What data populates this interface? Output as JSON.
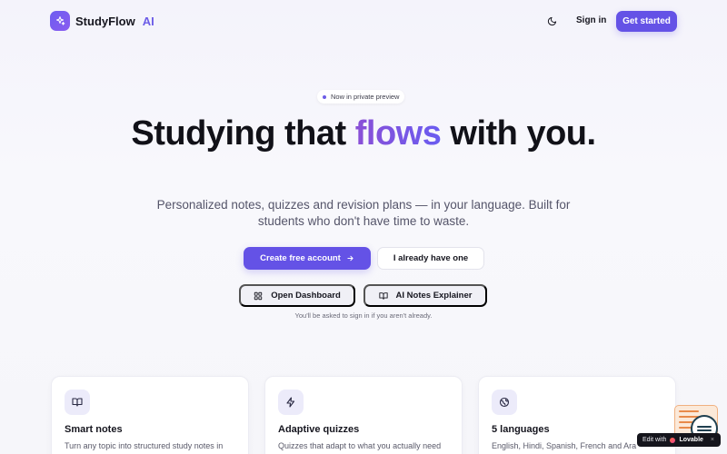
{
  "brand": {
    "name": "StudyFlow",
    "suffix": "AI"
  },
  "nav": {
    "signin": "Sign in",
    "get_started": "Get started"
  },
  "hero": {
    "badge": "Now in private preview",
    "headline_part1": "Studying that ",
    "headline_accent": "flows",
    "headline_part2": " with you.",
    "subhead": "Personalized notes, quizzes and revision plans — in your language. Built for students who don't have time to waste.",
    "primary_cta": "Create free account",
    "secondary_cta": "I already have one",
    "dashboard_cta": "Open Dashboard",
    "notes_cta": "AI Notes Explainer",
    "hint": "You'll be asked to sign in if you aren't already."
  },
  "features": [
    {
      "icon": "book-open-icon",
      "title": "Smart notes",
      "desc": "Turn any topic into structured study notes in"
    },
    {
      "icon": "lightning-icon",
      "title": "Adaptive quizzes",
      "desc": "Quizzes that adapt to what you actually need"
    },
    {
      "icon": "globe-icon",
      "title": "5 languages",
      "desc": "English, Hindi, Spanish, French and Ara"
    }
  ],
  "badge": {
    "edit": "Edit with",
    "brand": "Lovable"
  },
  "colors": {
    "accent": "#6452e6",
    "accent_gradient_start": "#8a4fd6",
    "accent_gradient_end": "#6a5cf0"
  }
}
